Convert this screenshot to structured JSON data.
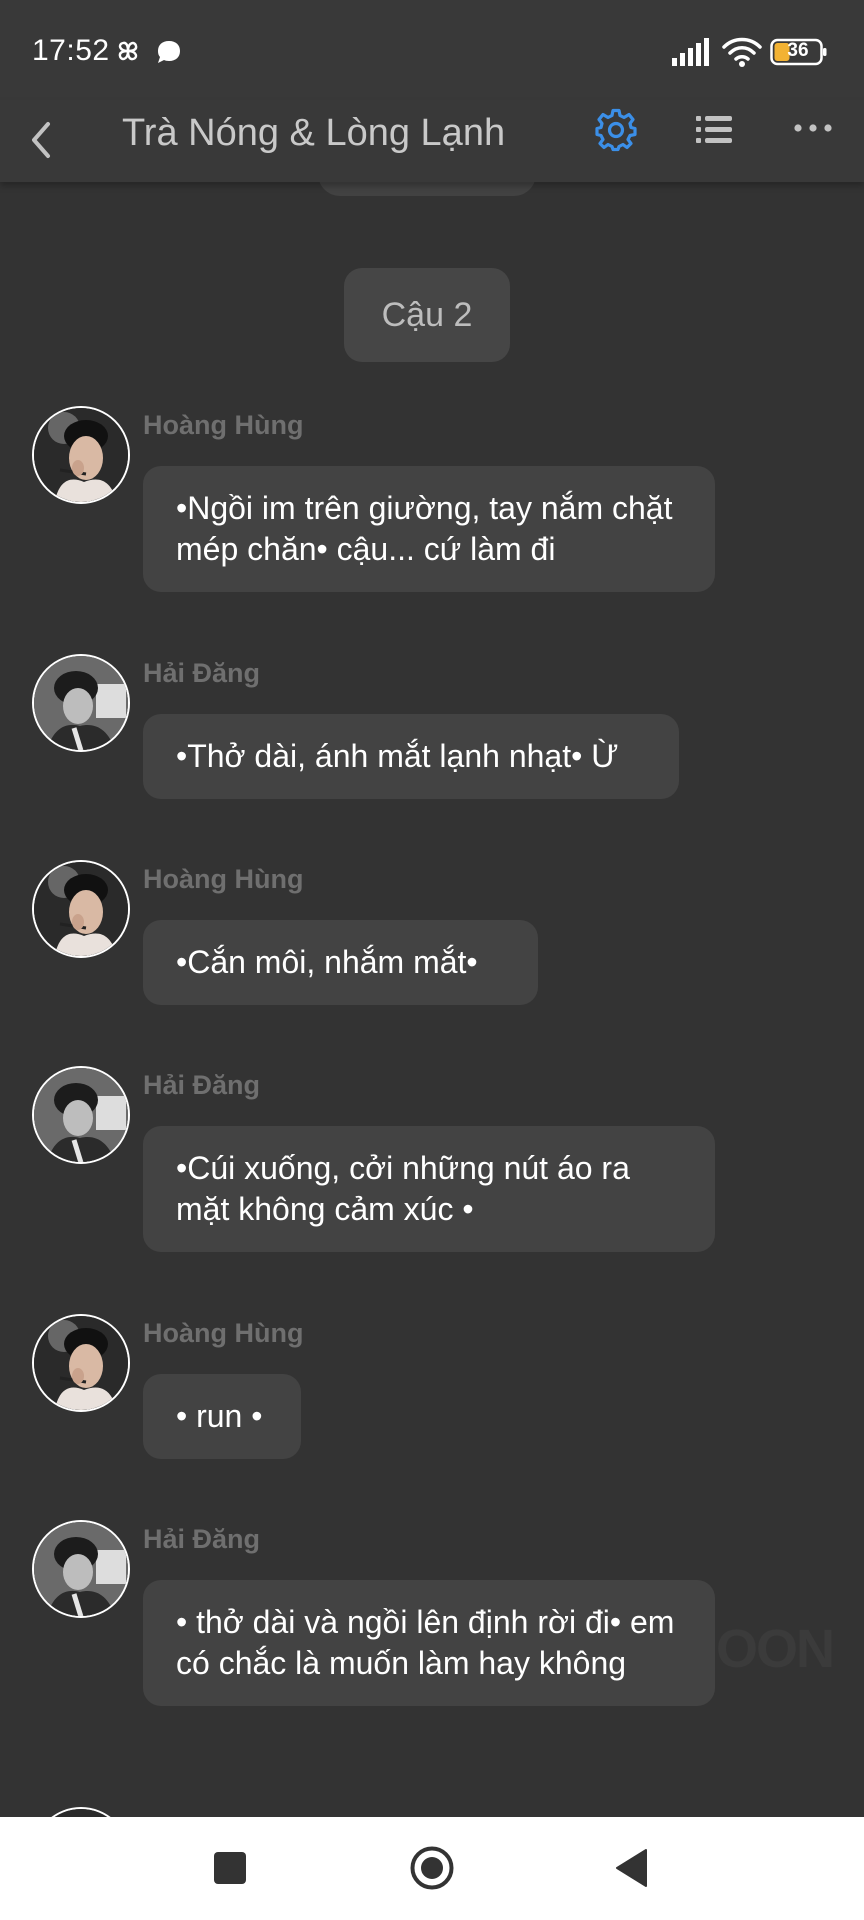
{
  "status_bar": {
    "time": "17:52",
    "notification_icons": [
      "pinwheel-icon",
      "chat-bubble-icon"
    ],
    "signal_icon": "signal-bars-icon",
    "wifi_icon": "wifi-icon",
    "battery_level": "36"
  },
  "header": {
    "back_icon": "back-chevron-icon",
    "title": "Trà Nóng & Lòng Lạnh",
    "settings_icon": "gear-icon",
    "list_icon": "list-icon",
    "more_icon": "more-dots-icon",
    "accent_color": "#3b8fe8"
  },
  "chapter_label": "Cậu 2",
  "messages": [
    {
      "sender": "Hoàng Hùng",
      "avatar": "hoang-hung-avatar",
      "text": "•Ngồi im trên giường, tay nắm chặt mép chăn• cậu... cứ làm đi"
    },
    {
      "sender": "Hải Đăng",
      "avatar": "hai-dang-avatar",
      "text": "•Thở dài, ánh mắt lạnh nhạt• Ừ"
    },
    {
      "sender": "Hoàng Hùng",
      "avatar": "hoang-hung-avatar",
      "text": "•Cắn môi, nhắm mắt•"
    },
    {
      "sender": "Hải Đăng",
      "avatar": "hai-dang-avatar",
      "text": "•Cúi xuống, cởi những nút áo ra mặt không cảm xúc •"
    },
    {
      "sender": "Hoàng Hùng",
      "avatar": "hoang-hung-avatar",
      "text": "• run •"
    },
    {
      "sender": "Hải Đăng",
      "avatar": "hai-dang-avatar",
      "text": "• thở dài và ngồi lên định rời đi• em có chắc là muốn làm hay không"
    }
  ],
  "watermark": "OON",
  "nav_bar": {
    "recents_icon": "square-icon",
    "home_icon": "circle-icon",
    "back_icon": "triangle-back-icon"
  }
}
